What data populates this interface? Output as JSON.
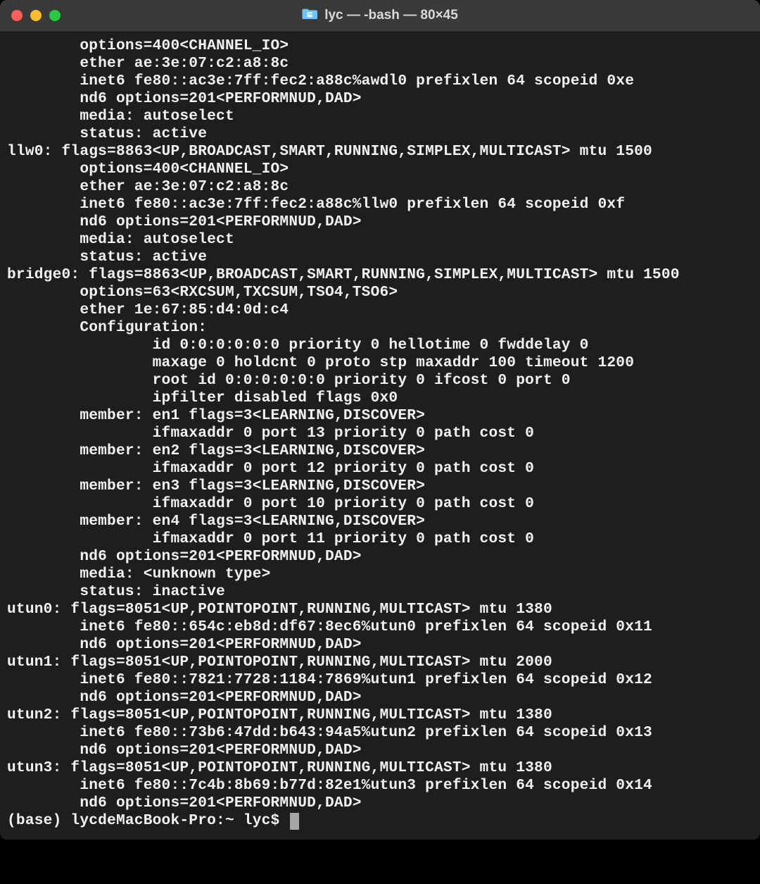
{
  "window": {
    "title": "lyc — -bash — 80×45"
  },
  "terminal": {
    "lines": [
      "        options=400<CHANNEL_IO>",
      "        ether ae:3e:07:c2:a8:8c",
      "        inet6 fe80::ac3e:7ff:fec2:a88c%awdl0 prefixlen 64 scopeid 0xe",
      "        nd6 options=201<PERFORMNUD,DAD>",
      "        media: autoselect",
      "        status: active",
      "llw0: flags=8863<UP,BROADCAST,SMART,RUNNING,SIMPLEX,MULTICAST> mtu 1500",
      "        options=400<CHANNEL_IO>",
      "        ether ae:3e:07:c2:a8:8c",
      "        inet6 fe80::ac3e:7ff:fec2:a88c%llw0 prefixlen 64 scopeid 0xf",
      "        nd6 options=201<PERFORMNUD,DAD>",
      "        media: autoselect",
      "        status: active",
      "bridge0: flags=8863<UP,BROADCAST,SMART,RUNNING,SIMPLEX,MULTICAST> mtu 1500",
      "        options=63<RXCSUM,TXCSUM,TSO4,TSO6>",
      "        ether 1e:67:85:d4:0d:c4",
      "        Configuration:",
      "                id 0:0:0:0:0:0 priority 0 hellotime 0 fwddelay 0",
      "                maxage 0 holdcnt 0 proto stp maxaddr 100 timeout 1200",
      "                root id 0:0:0:0:0:0 priority 0 ifcost 0 port 0",
      "                ipfilter disabled flags 0x0",
      "        member: en1 flags=3<LEARNING,DISCOVER>",
      "                ifmaxaddr 0 port 13 priority 0 path cost 0",
      "        member: en2 flags=3<LEARNING,DISCOVER>",
      "                ifmaxaddr 0 port 12 priority 0 path cost 0",
      "        member: en3 flags=3<LEARNING,DISCOVER>",
      "                ifmaxaddr 0 port 10 priority 0 path cost 0",
      "        member: en4 flags=3<LEARNING,DISCOVER>",
      "                ifmaxaddr 0 port 11 priority 0 path cost 0",
      "        nd6 options=201<PERFORMNUD,DAD>",
      "        media: <unknown type>",
      "        status: inactive",
      "utun0: flags=8051<UP,POINTOPOINT,RUNNING,MULTICAST> mtu 1380",
      "        inet6 fe80::654c:eb8d:df67:8ec6%utun0 prefixlen 64 scopeid 0x11",
      "        nd6 options=201<PERFORMNUD,DAD>",
      "utun1: flags=8051<UP,POINTOPOINT,RUNNING,MULTICAST> mtu 2000",
      "        inet6 fe80::7821:7728:1184:7869%utun1 prefixlen 64 scopeid 0x12",
      "        nd6 options=201<PERFORMNUD,DAD>",
      "utun2: flags=8051<UP,POINTOPOINT,RUNNING,MULTICAST> mtu 1380",
      "        inet6 fe80::73b6:47dd:b643:94a5%utun2 prefixlen 64 scopeid 0x13",
      "        nd6 options=201<PERFORMNUD,DAD>",
      "utun3: flags=8051<UP,POINTOPOINT,RUNNING,MULTICAST> mtu 1380",
      "        inet6 fe80::7c4b:8b69:b77d:82e1%utun3 prefixlen 64 scopeid 0x14",
      "        nd6 options=201<PERFORMNUD,DAD>"
    ],
    "prompt": "(base) lycdeMacBook-Pro:~ lyc$ "
  }
}
